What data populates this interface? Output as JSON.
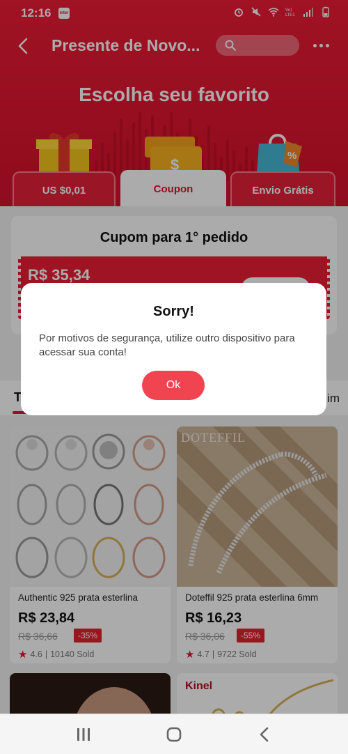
{
  "status_bar": {
    "time": "12:16",
    "app_badge": "inter"
  },
  "header": {
    "title": "Presente de Novo...",
    "headline": "Escolha seu favorito",
    "tabs": [
      {
        "label": "US $0,01"
      },
      {
        "label": "Coupon"
      },
      {
        "label": "Envio Grátis"
      }
    ]
  },
  "coupon": {
    "title": "Cupom para 1° pedido",
    "value": "R$ 35,34"
  },
  "product_tabs": {
    "left_label": "T",
    "right_label": "im"
  },
  "products": [
    {
      "name": "Authentic 925 prata esterlina",
      "price": "R$ 23,84",
      "old_price": "R$ 36,66",
      "discount": "-35%",
      "rating": "4.6",
      "sold": "10140 Sold"
    },
    {
      "brand": "DOTEFFIL",
      "name": "Doteffil 925 prata esterlina 6mm",
      "price": "R$ 16,23",
      "old_price": "R$ 36,06",
      "discount": "-55%",
      "rating": "4.7",
      "sold": "9722 Sold"
    },
    {
      "brand": "Kinel"
    }
  ],
  "dialog": {
    "title": "Sorry!",
    "message": "Por motivos de segurança, utilize outro dispositivo para acessar sua conta!",
    "ok_label": "Ok"
  },
  "colors": {
    "brand_red": "#e01530",
    "ok_button": "#f04450",
    "discount_badge": "#e3232f"
  },
  "icons": [
    "back-arrow-icon",
    "search-icon",
    "more-icon",
    "gift-box-icon",
    "coupon-icon",
    "shopping-bag-icon",
    "star-icon",
    "recent-apps-icon",
    "home-icon",
    "nav-back-icon"
  ]
}
